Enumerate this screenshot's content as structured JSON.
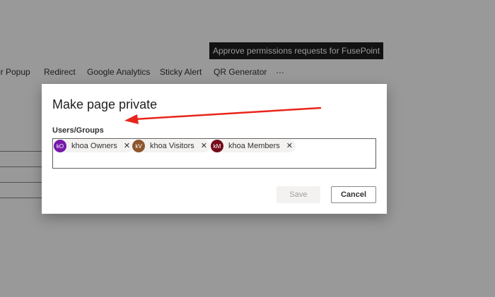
{
  "background": {
    "banner_text": "Approve permissions requests for FusePoint",
    "nav_items": [
      "er Popup",
      "Redirect",
      "Google Analytics",
      "Sticky Alert",
      "QR Generator",
      "···"
    ]
  },
  "modal": {
    "title": "Make page private",
    "field_label": "Users/Groups",
    "selected": [
      {
        "initials": "kO",
        "name": "khoa Owners",
        "remove": "✕",
        "color": "#7719aa"
      },
      {
        "initials": "kV",
        "name": "khoa Visitors",
        "remove": "✕",
        "color": "#8e562e"
      },
      {
        "initials": "kM",
        "name": "khoa Members",
        "remove": "✕",
        "color": "#750b1c"
      }
    ],
    "save_label": "Save",
    "cancel_label": "Cancel"
  },
  "annotation": {
    "arrow_color": "#e8251a",
    "arrow_icon": "red-arrow-icon"
  }
}
